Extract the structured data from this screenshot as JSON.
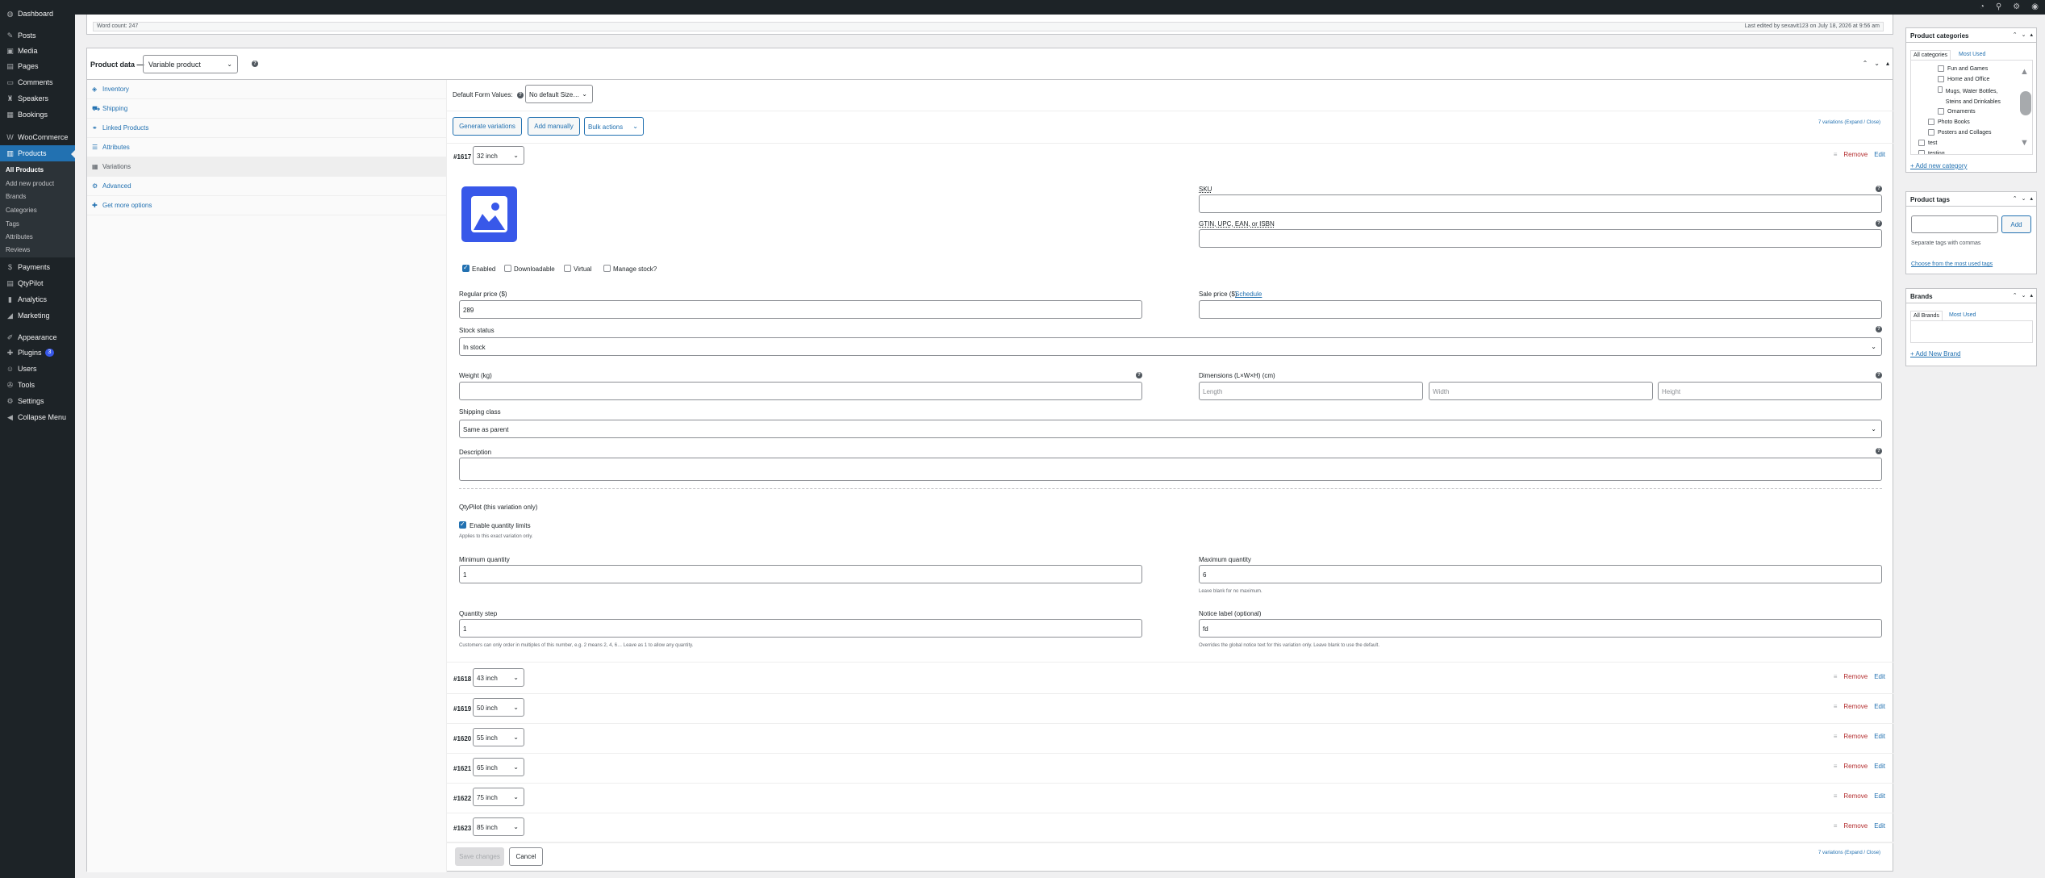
{
  "sidebar": {
    "items": [
      {
        "label": "Dashboard",
        "icon": "dashboard-icon",
        "glyph": "◍"
      },
      {
        "label": "Posts",
        "icon": "pin-icon",
        "glyph": "✎"
      },
      {
        "label": "Media",
        "icon": "media-icon",
        "glyph": "▣"
      },
      {
        "label": "Pages",
        "icon": "pages-icon",
        "glyph": "▤"
      },
      {
        "label": "Comments",
        "icon": "comments-icon",
        "glyph": "▭"
      },
      {
        "label": "Speakers",
        "icon": "speakers-icon",
        "glyph": "♜"
      },
      {
        "label": "Bookings",
        "icon": "bookings-icon",
        "glyph": "▦"
      },
      {
        "label": "WooCommerce",
        "icon": "woocommerce-icon",
        "glyph": "W"
      },
      {
        "label": "Products",
        "icon": "products-icon",
        "glyph": "▥"
      },
      {
        "label": "Payments",
        "icon": "payments-icon",
        "glyph": "$"
      },
      {
        "label": "QtyPilot",
        "icon": "qtypilot-icon",
        "glyph": "▤"
      },
      {
        "label": "Analytics",
        "icon": "analytics-icon",
        "glyph": "▮"
      },
      {
        "label": "Marketing",
        "icon": "marketing-icon",
        "glyph": "◢"
      },
      {
        "label": "Appearance",
        "icon": "appearance-icon",
        "glyph": "✐"
      },
      {
        "label": "Plugins",
        "icon": "plugins-icon",
        "glyph": "✚",
        "badge": "3"
      },
      {
        "label": "Users",
        "icon": "users-icon",
        "glyph": "☺"
      },
      {
        "label": "Tools",
        "icon": "tools-icon",
        "glyph": "✇"
      },
      {
        "label": "Settings",
        "icon": "settings-icon",
        "glyph": "⚙"
      },
      {
        "label": "Collapse Menu",
        "icon": "collapse-icon",
        "glyph": "◀"
      }
    ],
    "products_submenu": [
      "All Products",
      "Add new product",
      "Brands",
      "Categories",
      "Tags",
      "Attributes",
      "Reviews"
    ]
  },
  "word_count": {
    "left": "Word count: 247",
    "right": "Last edited by sexavit123 on July 18, 2026 at 9:56 am"
  },
  "product_data": {
    "title": "Product data —",
    "type": "Variable product"
  },
  "tabs": [
    "Inventory",
    "Shipping",
    "Linked Products",
    "Attributes",
    "Variations",
    "Advanced",
    "Get more options"
  ],
  "variations": {
    "default_form_label": "Default Form Values:",
    "default_form_value": "No default Size…",
    "generate": "Generate variations",
    "add_manually": "Add manually",
    "bulk_actions": "Bulk actions",
    "count_text": "7 variations (Expand / Close)",
    "remove": "Remove",
    "edit": "Edit",
    "expanded": {
      "id": "#1617",
      "size": "32 inch",
      "sku_label": "SKU",
      "gtin_label": "GTIN, UPC, EAN, or ISBN",
      "enabled": "Enabled",
      "downloadable": "Downloadable",
      "virtual": "Virtual",
      "manage_stock": "Manage stock?",
      "regular_price_label": "Regular price ($)",
      "regular_price": "289",
      "sale_price_label": "Sale price ($)",
      "schedule": "Schedule",
      "stock_status_label": "Stock status",
      "stock_status": "In stock",
      "weight_label": "Weight (kg)",
      "dimensions_label": "Dimensions (L×W×H) (cm)",
      "length_ph": "Length",
      "width_ph": "Width",
      "height_ph": "Height",
      "shipping_class_label": "Shipping class",
      "shipping_class": "Same as parent",
      "description_label": "Description",
      "qtypilot_title": "QtyPilot (this variation only)",
      "enable_limits": "Enable quantity limits",
      "applies_note": "Applies to this exact variation only.",
      "min_label": "Minimum quantity",
      "min_value": "1",
      "max_label": "Maximum quantity",
      "max_value": "6",
      "max_note": "Leave blank for no maximum.",
      "step_label": "Quantity step",
      "step_value": "1",
      "step_note": "Customers can only order in multiples of this number, e.g. 2 means 2, 4, 6… Leave as 1 to allow any quantity.",
      "notice_label": "Notice label (optional)",
      "notice_value": "fd",
      "notice_note": "Overrides the global notice text for this variation only. Leave blank to use the default."
    },
    "collapsed": [
      {
        "id": "#1618",
        "size": "43 inch"
      },
      {
        "id": "#1619",
        "size": "50 inch"
      },
      {
        "id": "#1620",
        "size": "55 inch"
      },
      {
        "id": "#1621",
        "size": "65 inch"
      },
      {
        "id": "#1622",
        "size": "75 inch"
      },
      {
        "id": "#1623",
        "size": "85 inch"
      }
    ],
    "save": "Save changes",
    "cancel": "Cancel"
  },
  "categories": {
    "title": "Product categories",
    "tab_all": "All categories",
    "tab_most": "Most Used",
    "items": [
      "Fun and Games",
      "Home and Office",
      "Mugs, Water Bottles, Steins and Drinkables",
      "Ornaments",
      "Photo Books",
      "Posters and Collages",
      "test",
      "testing"
    ],
    "add_link": "+ Add new category"
  },
  "tags": {
    "title": "Product tags",
    "add": "Add",
    "help": "Separate tags with commas",
    "choose": "Choose from the most used tags"
  },
  "brands": {
    "title": "Brands",
    "tab_all": "All Brands",
    "tab_most": "Most Used",
    "add_link": "+ Add New Brand"
  },
  "colors": {
    "accent": "#2271b1",
    "sidebar": "#1d2327",
    "active_menu": "#2271b1",
    "remove": "#b32d2e"
  }
}
